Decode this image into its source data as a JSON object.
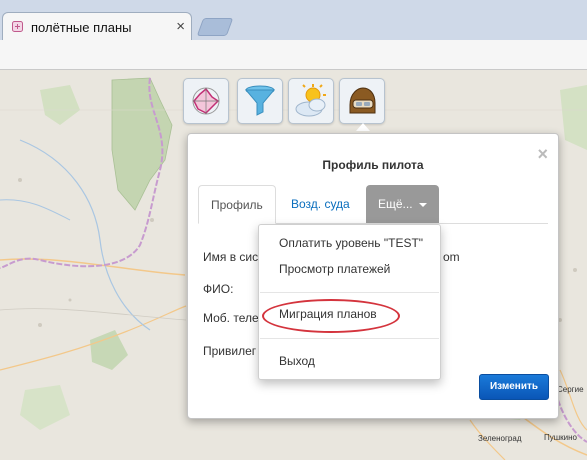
{
  "browser": {
    "tab_title": "полётные планы",
    "tab_close": "×"
  },
  "map": {
    "labels": {
      "zelenograd": "Зеленоград",
      "pushkino": "Пушкино",
      "sergiev": "Сергие"
    }
  },
  "toolbar": {
    "buttons": [
      {
        "name": "wind-rose-icon"
      },
      {
        "name": "filter-icon"
      },
      {
        "name": "weather-icon"
      },
      {
        "name": "pilot-helmet-icon"
      }
    ]
  },
  "modal": {
    "title": "Профиль пилота",
    "close": "×",
    "tabs": {
      "profile": "Профиль",
      "aircraft": "Возд. суда",
      "more": "Ещё..."
    },
    "fields": {
      "login": "Имя в сист",
      "login_value_tail": "om",
      "fio": "ФИО:",
      "phone": "Моб. теле",
      "privilege": "Привилег"
    },
    "submit": "Изменить"
  },
  "dropdown": {
    "pay": "Оплатить уровень \"TEST\"",
    "view_payments": "Просмотр платежей",
    "migration": "Миграция планов",
    "exit": "Выход"
  },
  "colors": {
    "accent_blue": "#0a6ebd",
    "button_blue": "#0a56b7",
    "highlight_red": "#d4343d"
  }
}
